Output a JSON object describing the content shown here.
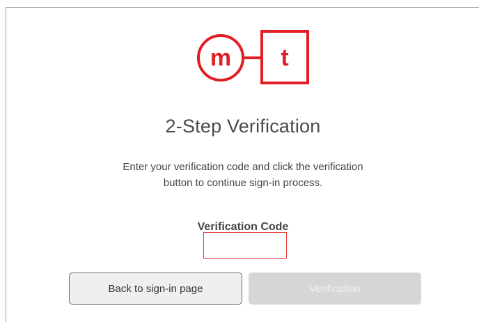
{
  "brand": {
    "logo_letter_circle": "m",
    "logo_letter_square": "t",
    "accent_color": "#e21d24"
  },
  "page": {
    "title": "2-Step Verification",
    "description": "Enter your verification code and click the verification button to continue sign-in process."
  },
  "form": {
    "code_label": "Verification Code",
    "code_value": "",
    "back_button_label": "Back to sign-in page",
    "verify_button_label": "Verification",
    "verify_button_state": "disabled"
  }
}
